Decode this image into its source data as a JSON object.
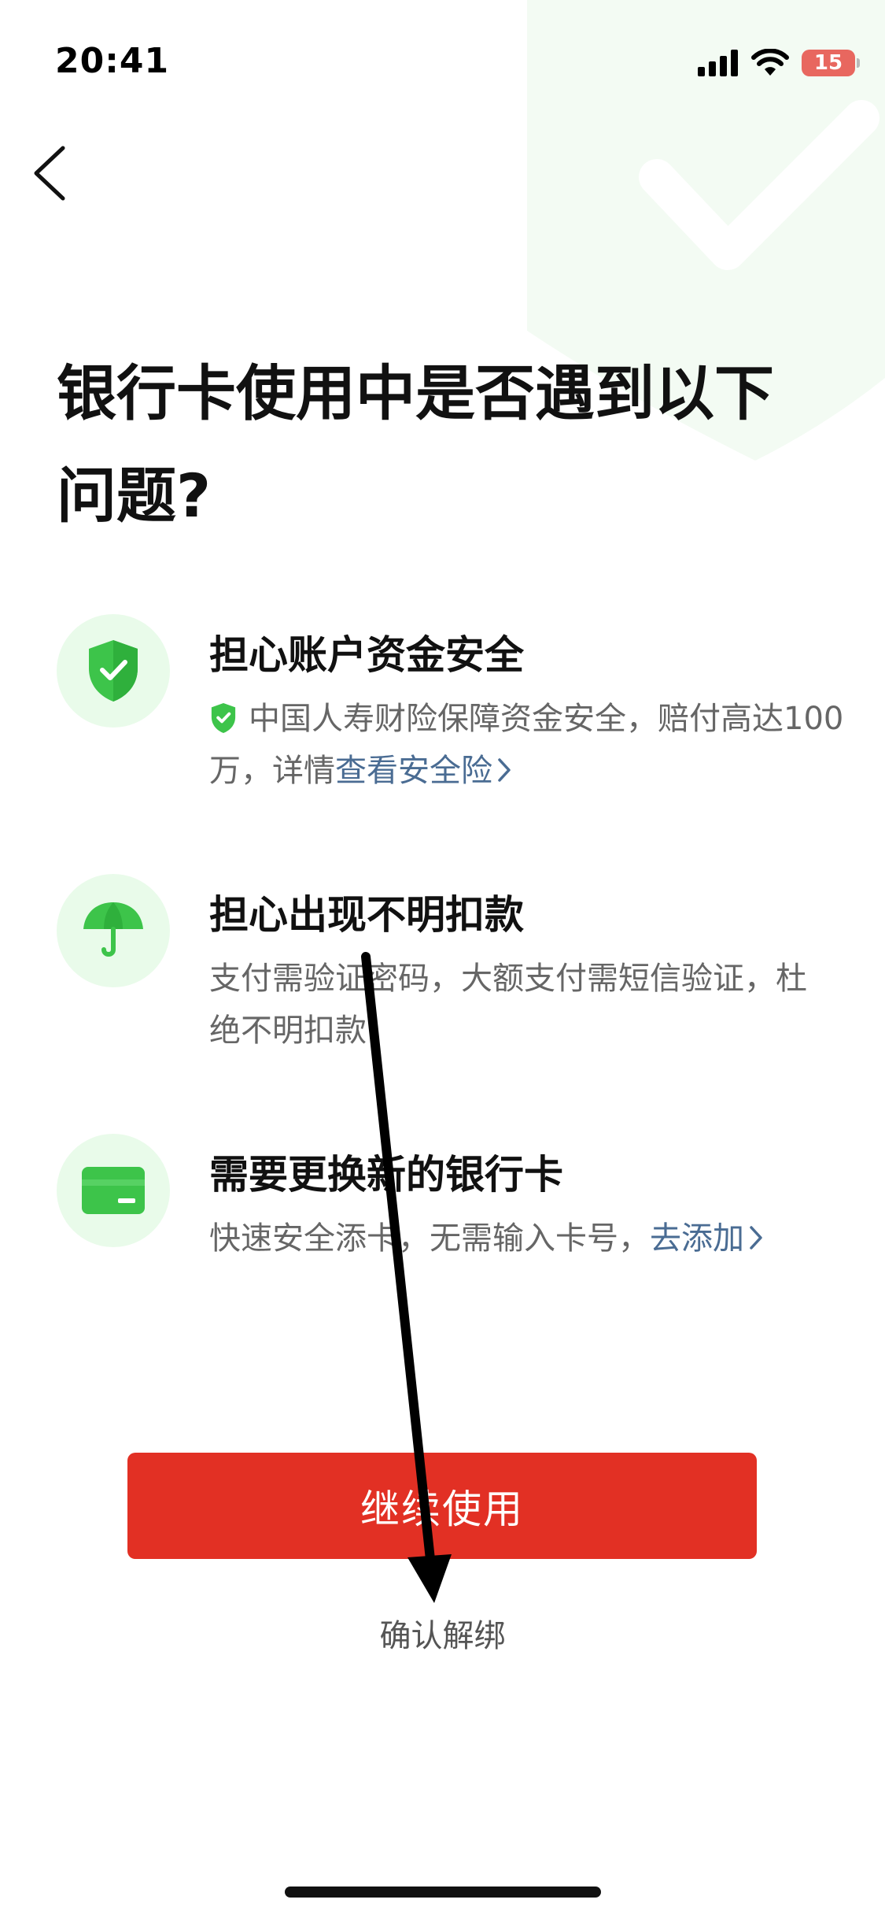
{
  "status_bar": {
    "time": "20:41",
    "battery": "15",
    "icons": [
      "signal-icon",
      "wifi-icon",
      "battery-charging-icon"
    ]
  },
  "nav": {
    "back_icon": "chevron-left-icon"
  },
  "page": {
    "title_line1": "银行卡使用中是否遇到以下",
    "title_line2": "问题?"
  },
  "features": [
    {
      "icon": "shield-check-icon",
      "title": "担心账户资金安全",
      "desc_text": "中国人寿财险保障资金安全，赔付高达100万，详情",
      "link": "查看安全险",
      "link_icon": "chevron-right-icon"
    },
    {
      "icon": "umbrella-icon",
      "title": "担心出现不明扣款",
      "desc_text": "支付需验证密码，大额支付需短信验证，杜绝不明扣款"
    },
    {
      "icon": "card-icon",
      "title": "需要更换新的银行卡",
      "desc_text": "快速安全添卡，无需输入卡号，",
      "link": "去添加",
      "link_icon": "chevron-right-icon"
    }
  ],
  "actions": {
    "continue_label": "继续使用",
    "unbind_label": "确认解绑"
  },
  "colors": {
    "brand_green": "#3dc44a",
    "primary_red": "#e23024",
    "link_blue": "#4a6c93",
    "icon_bg": "#e9fbea"
  }
}
